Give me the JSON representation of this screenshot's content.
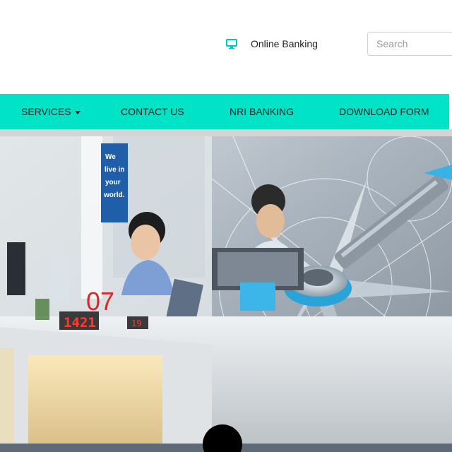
{
  "header": {
    "online_banking": {
      "label": "Online Banking",
      "icon": "monitor-icon"
    },
    "search": {
      "placeholder": "Search",
      "value": ""
    }
  },
  "nav": {
    "items": [
      {
        "label": "SERVICES",
        "has_dropdown": true
      },
      {
        "label": "CONTACT US"
      },
      {
        "label": "NRI BANKING"
      },
      {
        "label": "DOWNLOAD FORM"
      }
    ]
  },
  "hero": {
    "sign_text": [
      "We",
      "live in",
      "your",
      "world."
    ],
    "counter_display": "07",
    "token_display": "1421",
    "small_display": "19"
  },
  "colors": {
    "nav_background": "#00e3c6",
    "icon_accent": "#00c9c2",
    "slider_active": "#000000"
  }
}
